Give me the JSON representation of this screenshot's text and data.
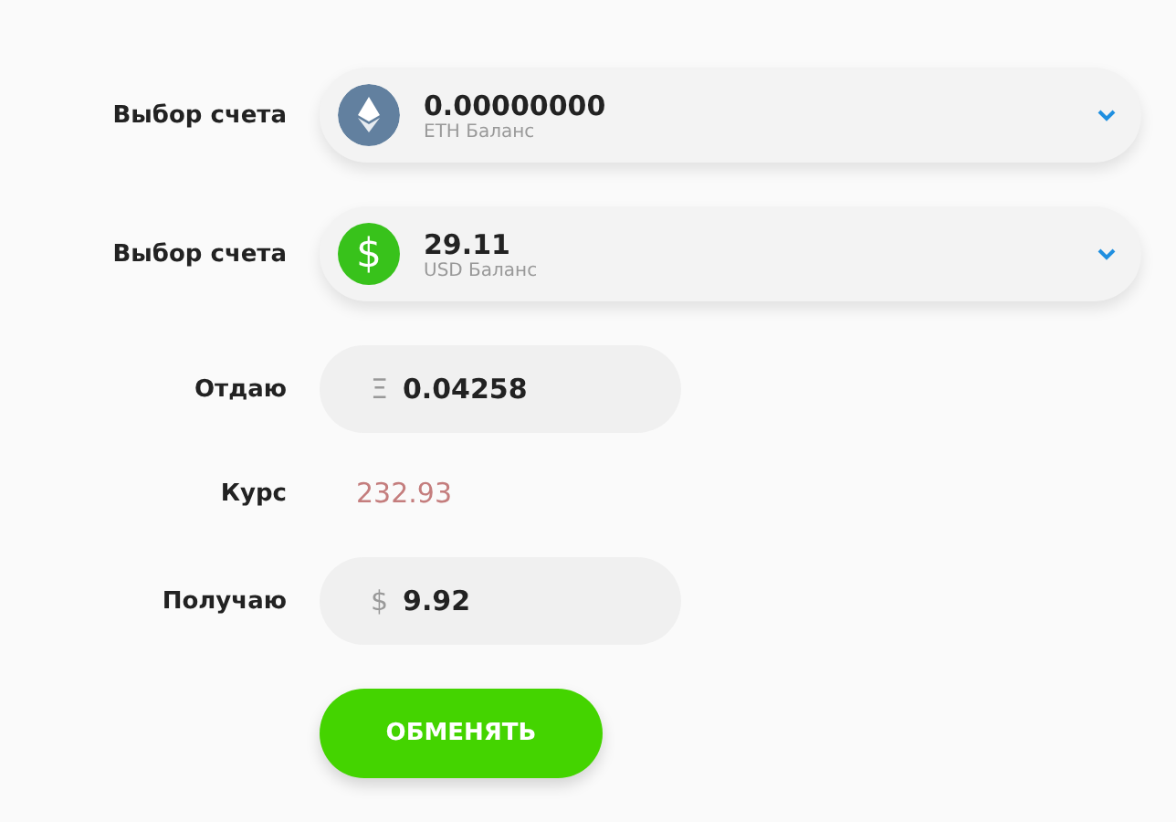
{
  "rows": [
    {
      "kind": "account",
      "label": "Выбор счета",
      "account": {
        "kind": "eth",
        "amount": "0.00000000",
        "caption": "ETH Баланс"
      }
    },
    {
      "kind": "account",
      "label": "Выбор счета",
      "account": {
        "kind": "usd",
        "icon_text": "$",
        "amount": "29.11",
        "caption": "USD Баланс"
      }
    },
    {
      "kind": "input",
      "label": "Отдаю",
      "symbol": "Ξ",
      "value": "0.04258"
    },
    {
      "kind": "rate",
      "label": "Курс",
      "value": "232.93"
    },
    {
      "kind": "input",
      "label": "Получаю",
      "symbol": "$",
      "value": "9.92"
    }
  ],
  "button": "ОБМЕНЯТЬ"
}
